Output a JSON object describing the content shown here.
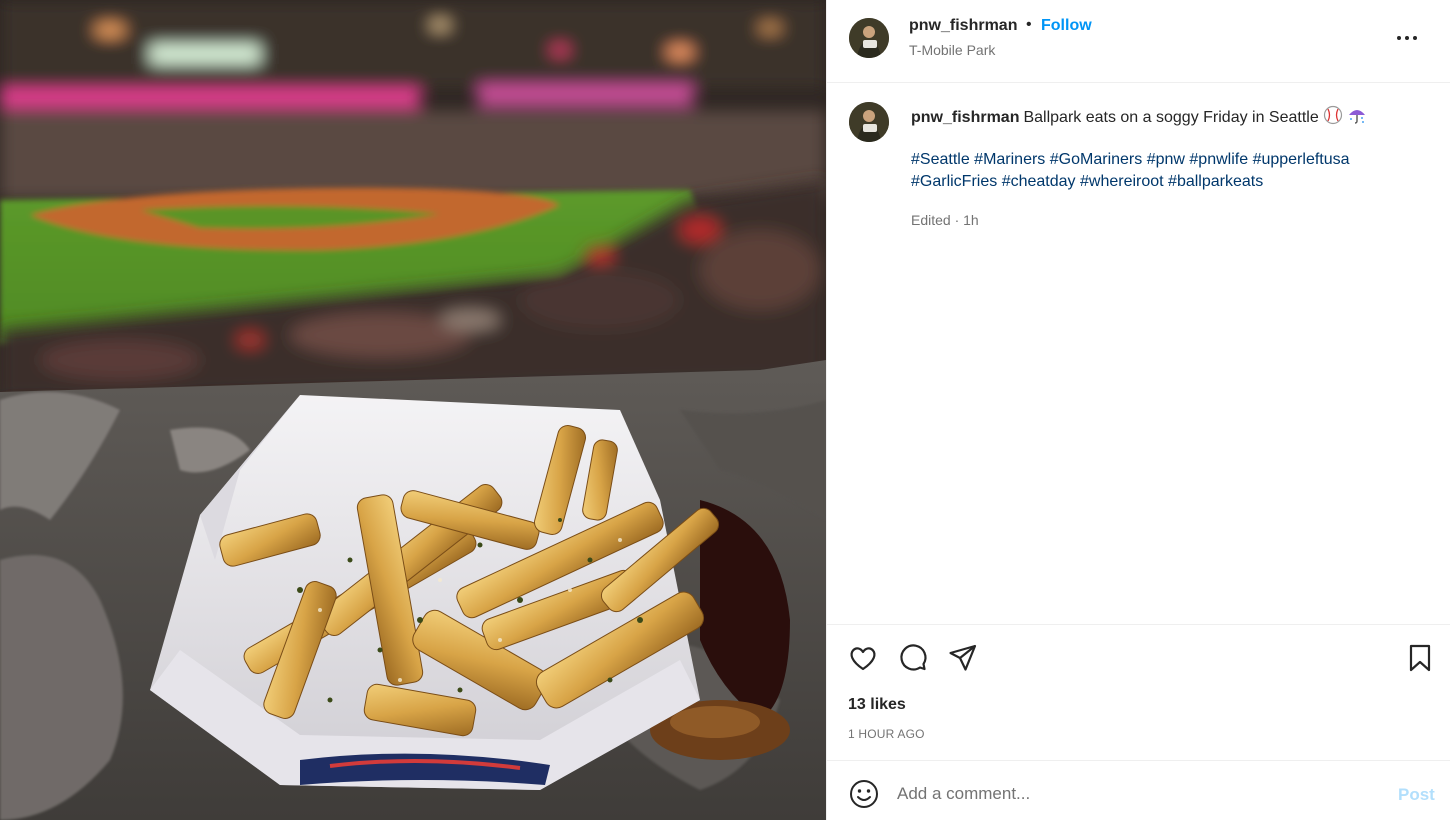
{
  "post": {
    "username": "pnw_fishrman",
    "separator": "•",
    "follow_label": "Follow",
    "location": "T-Mobile Park",
    "photo_alt": "Garlic fries at a ballpark"
  },
  "caption": {
    "username": "pnw_fishrman",
    "text": "Ballpark eats on a soggy Friday in Seattle",
    "emojis": [
      "baseball-icon",
      "umbrella-rain-icon"
    ],
    "hashtags": [
      "#Seattle",
      "#Mariners",
      "#GoMariners",
      "#pnw",
      "#pnwlife",
      "#upperleftusa",
      "#GarlicFries",
      "#cheatday",
      "#whereiroot",
      "#ballparkeats"
    ],
    "meta": "Edited · 1h"
  },
  "actions": {
    "icons": [
      "heart-icon",
      "comment-icon",
      "share-icon",
      "bookmark-icon"
    ],
    "likes": "13 likes",
    "timestamp": "1 HOUR AGO"
  },
  "comment_box": {
    "placeholder": "Add a comment...",
    "post_label": "Post"
  },
  "colors": {
    "follow": "#0095f6",
    "hashtag": "#00376b",
    "post_disabled": "#b2dffc",
    "muted": "#737373"
  }
}
